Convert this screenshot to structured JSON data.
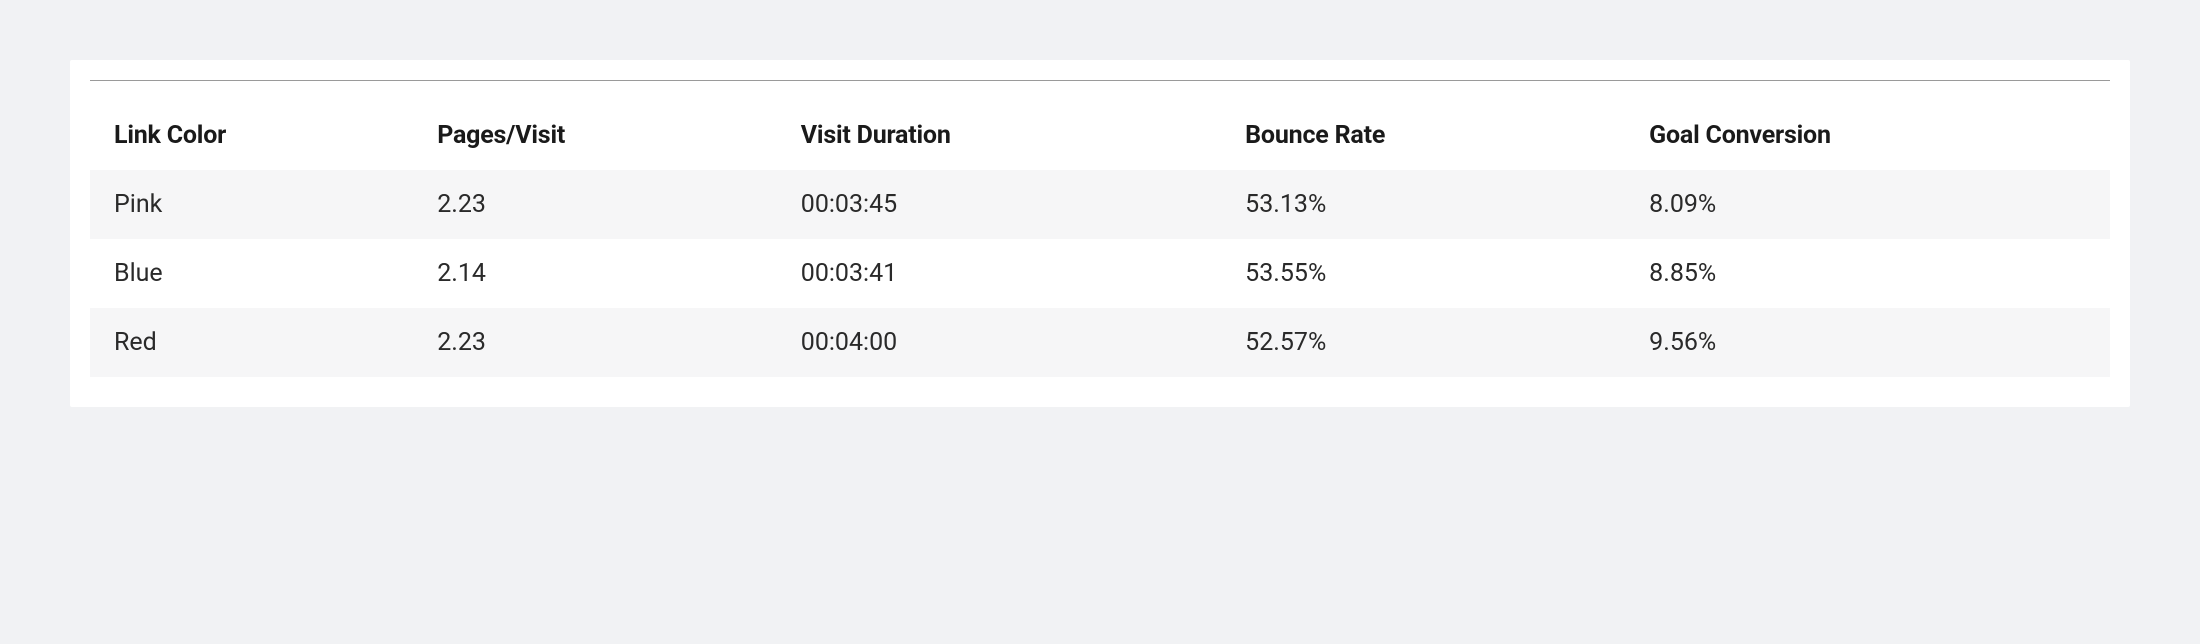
{
  "table": {
    "headers": {
      "link_color": "Link Color",
      "pages_visit": "Pages/Visit",
      "visit_duration": "Visit Duration",
      "bounce_rate": "Bounce Rate",
      "goal_conversion": "Goal Conversion"
    },
    "rows": [
      {
        "link_color": "Pink",
        "pages_visit": "2.23",
        "visit_duration": "00:03:45",
        "bounce_rate": "53.13%",
        "goal_conversion": "8.09%"
      },
      {
        "link_color": "Blue",
        "pages_visit": "2.14",
        "visit_duration": "00:03:41",
        "bounce_rate": "53.55%",
        "goal_conversion": "8.85%"
      },
      {
        "link_color": "Red",
        "pages_visit": "2.23",
        "visit_duration": "00:04:00",
        "bounce_rate": "52.57%",
        "goal_conversion": "9.56%"
      }
    ]
  }
}
